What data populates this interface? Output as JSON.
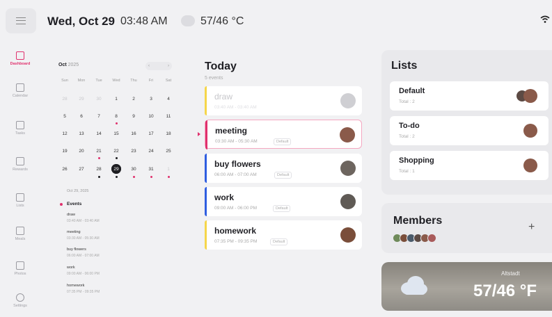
{
  "header": {
    "date": "Wed, Oct 29",
    "time": "03:48 AM",
    "temperature": "57/46 °C"
  },
  "sidebar": {
    "items": [
      {
        "label": "Dashboard",
        "icon": "dashboard-icon",
        "active": true
      },
      {
        "label": "Calendar",
        "icon": "calendar-icon",
        "active": false
      },
      {
        "label": "Tasks",
        "icon": "tasks-icon",
        "active": false
      },
      {
        "label": "Rewards",
        "icon": "star-icon",
        "active": false
      },
      {
        "label": "Lists",
        "icon": "list-icon",
        "active": false
      },
      {
        "label": "Meals",
        "icon": "meals-icon",
        "active": false
      },
      {
        "label": "Photos",
        "icon": "photo-icon",
        "active": false
      },
      {
        "label": "Settings",
        "icon": "gear-icon",
        "active": false
      }
    ]
  },
  "calendar": {
    "month": "Oct",
    "year": "2025",
    "nav": {
      "prev": "‹",
      "next": "›"
    },
    "weekdays": [
      "Sun",
      "Mon",
      "Tue",
      "Wed",
      "Thu",
      "Fri",
      "Sat"
    ],
    "weeks": [
      [
        "28",
        "29",
        "30",
        "1",
        "2",
        "3",
        "4"
      ],
      [
        "5",
        "6",
        "7",
        "8",
        "9",
        "10",
        "11"
      ],
      [
        "12",
        "13",
        "14",
        "15",
        "16",
        "17",
        "18"
      ],
      [
        "19",
        "20",
        "21",
        "22",
        "23",
        "24",
        "25"
      ],
      [
        "26",
        "27",
        "28",
        "29",
        "30",
        "31",
        "1"
      ]
    ],
    "selected_date": "Oct 29, 2025",
    "events_title": "Events",
    "events": [
      {
        "name": "draw",
        "time": "03:40 AM - 03:40 AM"
      },
      {
        "name": "meeting",
        "time": "03:30 AM - 05:30 AM"
      },
      {
        "name": "buy flowers",
        "time": "06:00 AM - 07:00 AM"
      },
      {
        "name": "work",
        "time": "09:00 AM - 06:00 PM"
      },
      {
        "name": "homework",
        "time": "07:35 PM - 09:35 PM"
      }
    ]
  },
  "today": {
    "title": "Today",
    "subtitle": "5 events",
    "cards": [
      {
        "title": "draw",
        "time": "03:40 AM - 03:40 AM",
        "tag": "Default",
        "color": "#f5d64a"
      },
      {
        "title": "meeting",
        "time": "03:30 AM - 05:30 AM",
        "tag": "Default",
        "color": "#e0316d"
      },
      {
        "title": "buy flowers",
        "time": "06:00 AM - 07:00 AM",
        "tag": "Default",
        "color": "#2f5ee0"
      },
      {
        "title": "work",
        "time": "09:00 AM - 06:00 PM",
        "tag": "Default",
        "color": "#2f5ee0"
      },
      {
        "title": "homework",
        "time": "07:35 PM - 09:35 PM",
        "tag": "Default",
        "color": "#f5d64a"
      }
    ]
  },
  "lists": {
    "title": "Lists",
    "items": [
      {
        "name": "Default",
        "total": "Total : 2"
      },
      {
        "name": "To-do",
        "total": "Total : 2"
      },
      {
        "name": "Shopping",
        "total": "Total : 1"
      }
    ]
  },
  "members": {
    "title": "Members",
    "add": "+"
  },
  "weather": {
    "city": "Altstadt",
    "temperature": "57/46 °F"
  },
  "colors": {
    "accent": "#e0316d",
    "blue": "#2f5ee0",
    "yellow": "#f5d64a"
  }
}
